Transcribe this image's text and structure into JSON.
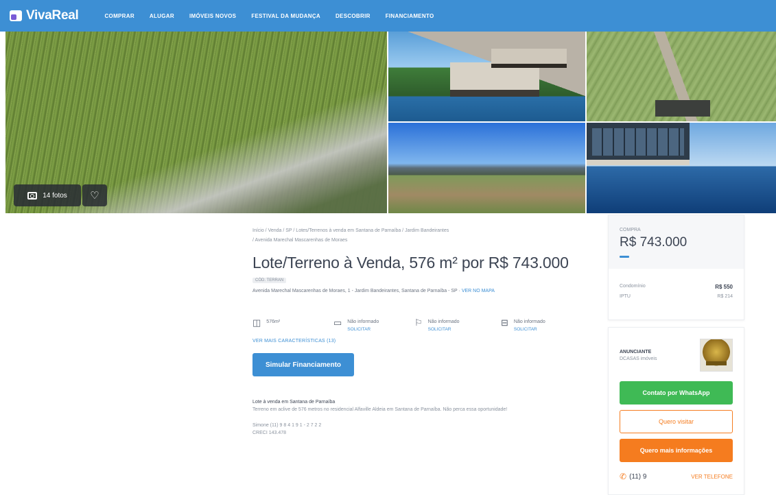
{
  "header": {
    "logo": "VivaReal",
    "nav": [
      "COMPRAR",
      "ALUGAR",
      "IMÓVEIS NOVOS",
      "FESTIVAL DA MUDANÇA",
      "DESCOBRIR",
      "FINANCIAMENTO"
    ]
  },
  "gallery": {
    "photos_label": "14 fotos"
  },
  "main": {
    "breadcrumb_line1": "Início / Venda / SP / Lotes/Terrenos à venda em Santana de Parnaíba / Jardim Bandeirantes",
    "breadcrumb_line2": "/ Avenida Marechal Mascarenhas de Moraes",
    "title": "Lote/Terreno à Venda, 576 m² por R$ 743.000",
    "code": "CÓD. TERRAN",
    "address": "Avenida Marechal Mascarenhas de Moraes, 1 - Jardim Bandeirantes, Santana de Parnaíba - SP",
    "address_link": "VER NO MAPA",
    "features": [
      {
        "icon": "area-icon",
        "glyph": "◫",
        "text": "576m²",
        "link": ""
      },
      {
        "icon": "bed-icon",
        "glyph": "▭",
        "text": "Não informado",
        "link": "SOLICITAR"
      },
      {
        "icon": "shower-icon",
        "glyph": "⚐",
        "text": "Não informado",
        "link": "SOLICITAR"
      },
      {
        "icon": "car-icon",
        "glyph": "⊟",
        "text": "Não informado",
        "link": "SOLICITAR"
      }
    ],
    "more_features": "VER MAIS CARACTERÍSTICAS (13)",
    "financing_button": "Simular Financiamento",
    "description_title": "Lote à venda em Santana de Parnaíba",
    "description_body": "Terreno em aclive de 576 metros no residencial Alfaville Aldeia em Santana de Parnaíba. Não perca essa oportunidade!",
    "description_extra1": "Simone (11) 9 8 4 1 9 1 - 2 7 2 2",
    "description_extra2": "CRECI 143.478"
  },
  "price_card": {
    "label": "COMPRA",
    "price": "R$ 743.000",
    "rows": [
      {
        "label": "Condomínio",
        "value": "R$ 550"
      },
      {
        "label": "IPTU",
        "value": "R$ 214"
      }
    ]
  },
  "advertiser": {
    "label": "ANUNCIANTE",
    "name": "DCASAS imóveis",
    "whatsapp_button": "Contato por WhatsApp",
    "visit_button": "Quero visitar",
    "info_button": "Quero mais informações",
    "phone": "(11) 9",
    "phone_link": "VER TELEFONE"
  },
  "colors": {
    "brand_blue": "#3d8fd4",
    "whatsapp_green": "#3fba55",
    "accent_orange": "#f57c1f"
  }
}
